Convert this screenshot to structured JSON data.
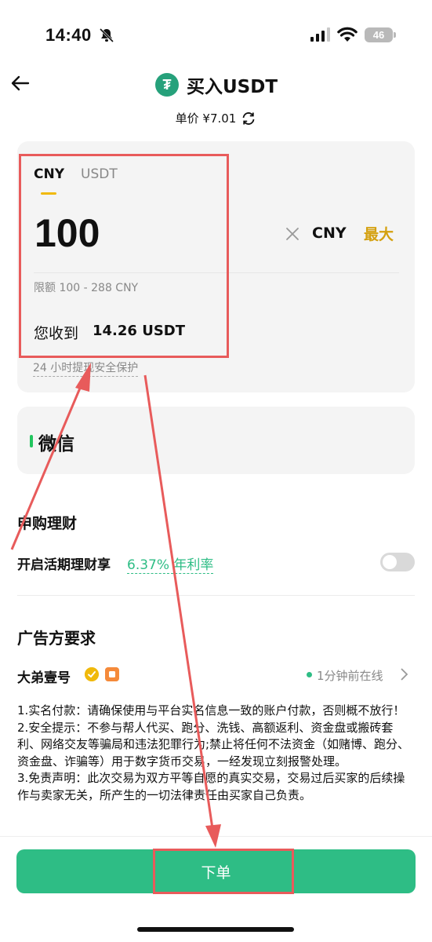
{
  "status_bar": {
    "time": "14:40",
    "battery": "46"
  },
  "header": {
    "title": "买入USDT",
    "tether_symbol": "₮",
    "price": "单价 ¥7.01"
  },
  "amount_card": {
    "tabs": [
      "CNY",
      "USDT"
    ],
    "amount": "100",
    "currency": "CNY",
    "max_label": "最大",
    "limit": "限额 100 - 288 CNY",
    "receive_label": "您收到",
    "receive_value": "14.26 USDT",
    "protection": "24 小时提现安全保护"
  },
  "payment": {
    "method": "微信"
  },
  "finance": {
    "title": "申购理财",
    "text": "开启活期理财享",
    "rate": "6.37% 年利率",
    "toggle_on": false
  },
  "advertiser": {
    "section_title": "广告方要求",
    "name": "大弟壹号",
    "online": "1分钟前在线",
    "rules": [
      "1.实名付款：请确保使用与平台实名信息一致的账户付款，否则概不放行！",
      "2.安全提示：不参与帮人代买、跑分、洗钱、高额返利、资金盘或搬砖套利、网络交友等骗局和违法犯罪行为;禁止将任何不法资金（如赌博、跑分、资金盘、诈骗等）用于数字货币交易，一经发现立刻报警处理。",
      "3.免责声明：此次交易为双方平等自愿的真实交易，交易过后买家的后续操作与卖家无关，所产生的一切法律责任由买家自己负责。"
    ]
  },
  "order_button": "下单",
  "colors": {
    "accent_green": "#2ebd85",
    "gold": "#d4a00f",
    "annotation_red": "#e85b5b"
  }
}
